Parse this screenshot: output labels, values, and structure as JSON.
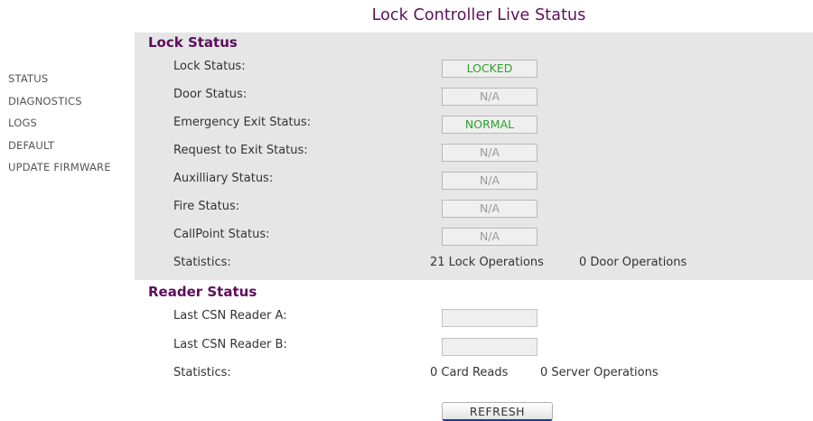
{
  "page": {
    "title": "Lock Controller Live Status"
  },
  "nav": {
    "items": [
      {
        "label": "STATUS"
      },
      {
        "label": "DIAGNOSTICS"
      },
      {
        "label": "LOGS"
      },
      {
        "label": "DEFAULT"
      },
      {
        "label": "UPDATE FIRMWARE"
      }
    ]
  },
  "lock_status": {
    "title": "Lock Status",
    "rows": [
      {
        "label": "Lock Status:",
        "value": "LOCKED"
      },
      {
        "label": "Door Status:",
        "value": "N/A"
      },
      {
        "label": "Emergency Exit Status:",
        "value": "NORMAL"
      },
      {
        "label": "Request to Exit Status:",
        "value": "N/A"
      },
      {
        "label": "Auxilliary Status:",
        "value": "N/A"
      },
      {
        "label": "Fire Status:",
        "value": "N/A"
      },
      {
        "label": "CallPoint Status:",
        "value": "N/A"
      }
    ],
    "statistics": {
      "label": "Statistics:",
      "lock_ops": "21 Lock Operations",
      "door_ops": "0 Door Operations"
    }
  },
  "reader_status": {
    "title": "Reader Status",
    "rows": [
      {
        "label": "Last CSN Reader A:",
        "value": ""
      },
      {
        "label": "Last CSN Reader B:",
        "value": ""
      }
    ],
    "statistics": {
      "label": "Statistics:",
      "card_reads": "0 Card Reads",
      "server_ops": "0 Server Operations"
    }
  },
  "actions": {
    "refresh_label": "REFRESH"
  },
  "colors": {
    "title": "#5c0f5c",
    "ok": "#2ea02e",
    "na": "#9a9a9a",
    "panel": "#e6e6e6"
  }
}
